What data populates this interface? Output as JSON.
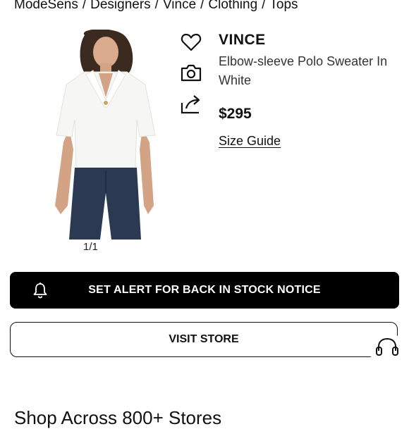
{
  "breadcrumb": {
    "items": [
      "ModeSens",
      "Designers",
      "Vince",
      "Clothing",
      "Tops"
    ],
    "separator": "/"
  },
  "gallery": {
    "counter": "1/1"
  },
  "actions": {
    "icons": [
      "heart-icon",
      "camera-icon",
      "share-icon"
    ]
  },
  "product": {
    "brand": "VINCE",
    "name": "Elbow-sleeve Polo Sweater In White",
    "price": "$295",
    "size_guide": "Size Guide"
  },
  "buttons": {
    "alert_label": "SET ALERT FOR BACK IN STOCK NOTICE",
    "visit_label": "VISIT STORE"
  },
  "section": {
    "title": "Shop Across 800+ Stores"
  },
  "colors": {
    "primary": "#000000",
    "background": "#ffffff",
    "text": "#111111"
  }
}
